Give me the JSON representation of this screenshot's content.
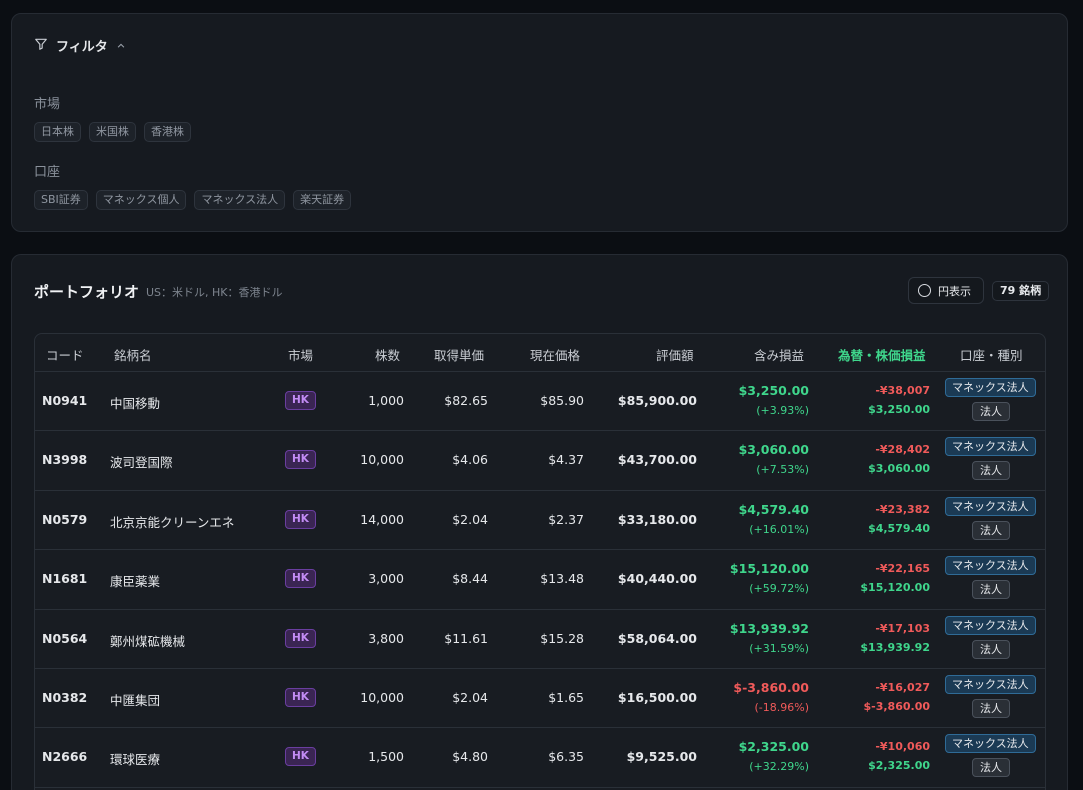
{
  "filter": {
    "title": "フィルタ",
    "market_label": "市場",
    "markets": [
      "日本株",
      "米国株",
      "香港株"
    ],
    "account_label": "口座",
    "accounts": [
      "SBI証券",
      "マネックス個人",
      "マネックス法人",
      "楽天証券"
    ]
  },
  "portfolio": {
    "title": "ポートフォリオ",
    "subtitle": "US：米ドル, HK：香港ドル",
    "yen_toggle_label": "円表示",
    "count_badge": "79 銘柄",
    "columns": [
      "コード",
      "銘柄名",
      "市場",
      "株数",
      "取得単価",
      "現在価格",
      "評価額",
      "含み損益",
      "為替・株価損益",
      "口座・種別"
    ],
    "rows": [
      {
        "code": "N0941",
        "name": "中国移動",
        "market": "HK",
        "shares": "1,000",
        "cost": "$82.65",
        "price": "$85.90",
        "value": "$85,900.00",
        "pl": "$3,250.00",
        "pl_pct": "(+3.93%)",
        "pl_sign": "pos",
        "fx_yen": "-¥38,007",
        "fx_usd": "$3,250.00",
        "fx_usd_sign": "pos",
        "account": "マネックス法人",
        "kind": "法人"
      },
      {
        "code": "N3998",
        "name": "波司登国際",
        "market": "HK",
        "shares": "10,000",
        "cost": "$4.06",
        "price": "$4.37",
        "value": "$43,700.00",
        "pl": "$3,060.00",
        "pl_pct": "(+7.53%)",
        "pl_sign": "pos",
        "fx_yen": "-¥28,402",
        "fx_usd": "$3,060.00",
        "fx_usd_sign": "pos",
        "account": "マネックス法人",
        "kind": "法人"
      },
      {
        "code": "N0579",
        "name": "北京京能クリーンエネ",
        "market": "HK",
        "shares": "14,000",
        "cost": "$2.04",
        "price": "$2.37",
        "value": "$33,180.00",
        "pl": "$4,579.40",
        "pl_pct": "(+16.01%)",
        "pl_sign": "pos",
        "fx_yen": "-¥23,382",
        "fx_usd": "$4,579.40",
        "fx_usd_sign": "pos",
        "account": "マネックス法人",
        "kind": "法人"
      },
      {
        "code": "N1681",
        "name": "康臣薬業",
        "market": "HK",
        "shares": "3,000",
        "cost": "$8.44",
        "price": "$13.48",
        "value": "$40,440.00",
        "pl": "$15,120.00",
        "pl_pct": "(+59.72%)",
        "pl_sign": "pos",
        "fx_yen": "-¥22,165",
        "fx_usd": "$15,120.00",
        "fx_usd_sign": "pos",
        "account": "マネックス法人",
        "kind": "法人"
      },
      {
        "code": "N0564",
        "name": "鄭州煤砿機械",
        "market": "HK",
        "shares": "3,800",
        "cost": "$11.61",
        "price": "$15.28",
        "value": "$58,064.00",
        "pl": "$13,939.92",
        "pl_pct": "(+31.59%)",
        "pl_sign": "pos",
        "fx_yen": "-¥17,103",
        "fx_usd": "$13,939.92",
        "fx_usd_sign": "pos",
        "account": "マネックス法人",
        "kind": "法人"
      },
      {
        "code": "N0382",
        "name": "中匯集団",
        "market": "HK",
        "shares": "10,000",
        "cost": "$2.04",
        "price": "$1.65",
        "value": "$16,500.00",
        "pl": "$-3,860.00",
        "pl_pct": "(-18.96%)",
        "pl_sign": "neg",
        "fx_yen": "-¥16,027",
        "fx_usd": "$-3,860.00",
        "fx_usd_sign": "neg",
        "account": "マネックス法人",
        "kind": "法人"
      },
      {
        "code": "N2666",
        "name": "環球医療",
        "market": "HK",
        "shares": "1,500",
        "cost": "$4.80",
        "price": "$6.35",
        "value": "$9,525.00",
        "pl": "$2,325.00",
        "pl_pct": "(+32.29%)",
        "pl_sign": "pos",
        "fx_yen": "-¥10,060",
        "fx_usd": "$2,325.00",
        "fx_usd_sign": "pos",
        "account": "マネックス法人",
        "kind": "法人"
      }
    ]
  },
  "colors": {
    "positive": "#3fd68c",
    "negative": "#f05a5a",
    "market_badge": "#c38cf5",
    "account_badge": "#2f6b97"
  },
  "icons": {
    "filter": "filter-funnel-icon",
    "collapse": "chevron-up-icon",
    "yen_toggle": "radio-circle-icon"
  }
}
